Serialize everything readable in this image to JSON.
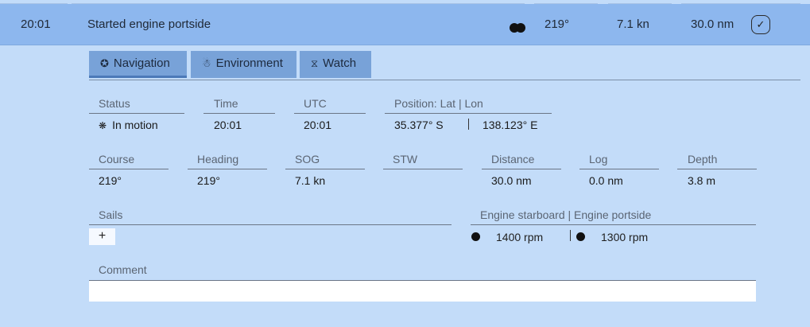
{
  "entry": {
    "time": "20:01",
    "title": "Started engine portside",
    "engine_icon": "engine-status-dots-icon",
    "course": "219°",
    "speed": "7.1 kn",
    "distance": "30.0 nm",
    "check_icon": "checkmark-icon",
    "check_glyph": "✓"
  },
  "tabs": [
    {
      "label": "Navigation",
      "icon": "navigation-icon",
      "glyph": "✪",
      "active": true
    },
    {
      "label": "Environment",
      "icon": "environment-icon",
      "glyph": "☃",
      "active": false
    },
    {
      "label": "Watch",
      "icon": "hourglass-icon",
      "glyph": "⧖",
      "active": false
    }
  ],
  "fields": {
    "status": {
      "label": "Status",
      "value": "In motion",
      "icon": "motion-icon",
      "glyph": "❋"
    },
    "time": {
      "label": "Time",
      "value": "20:01"
    },
    "utc": {
      "label": "UTC",
      "value": "20:01"
    },
    "position": {
      "label": "Position: Lat | Lon",
      "lat": "35.377° S",
      "lon": "138.123° E"
    },
    "course": {
      "label": "Course",
      "value": "219°"
    },
    "heading": {
      "label": "Heading",
      "value": "219°"
    },
    "sog": {
      "label": "SOG",
      "value": "7.1 kn"
    },
    "stw": {
      "label": "STW",
      "value": ""
    },
    "distance": {
      "label": "Distance",
      "value": "30.0 nm"
    },
    "log": {
      "label": "Log",
      "value": "0.0 nm"
    },
    "depth": {
      "label": "Depth",
      "value": "3.8 m"
    },
    "sails": {
      "label": "Sails",
      "add_label": "+"
    },
    "engines": {
      "label": "Engine starboard | Engine portside",
      "starboard": "1400 rpm",
      "portside": "1300 rpm"
    },
    "comment": {
      "label": "Comment",
      "value": ""
    }
  },
  "colors": {
    "background": "#c3dcf9",
    "header_row": "#8db7ee",
    "tab": "#78a2d8"
  }
}
